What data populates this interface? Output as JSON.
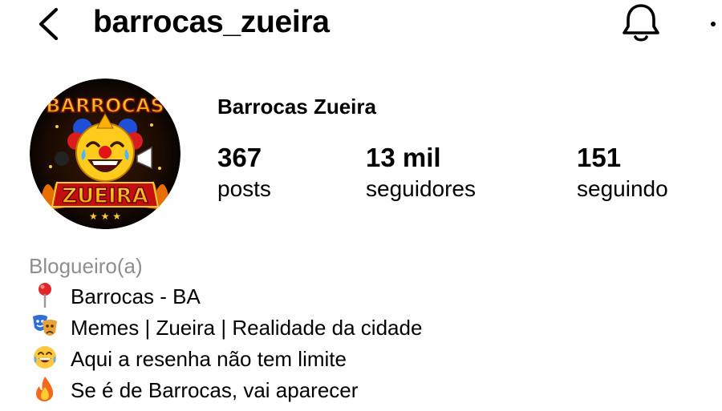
{
  "header": {
    "username": "barrocas_zueira",
    "back_icon": "chevron-left-icon",
    "bell_icon": "bell-icon",
    "more_icon": "more-dots-icon"
  },
  "profile": {
    "display_name": "Barrocas Zueira",
    "avatar_text_top": "BARROCAS",
    "avatar_text_bottom": "ZUEIRA",
    "stats": {
      "posts": {
        "value": "367",
        "label": "posts"
      },
      "followers": {
        "value": "13 mil",
        "label": "seguidores"
      },
      "following": {
        "value": "151",
        "label": "seguindo"
      }
    }
  },
  "bio": {
    "category": "Blogueiro(a)",
    "lines": [
      {
        "icon": "pin-icon",
        "text": "Barrocas - BA"
      },
      {
        "icon": "theater-masks-icon",
        "text": "Memes | Zueira | Realidade da cidade"
      },
      {
        "icon": "laughing-emoji-icon",
        "text": "Aqui a resenha não tem limite"
      },
      {
        "icon": "fire-icon",
        "text": "Se é de Barrocas, vai aparecer"
      }
    ]
  },
  "colors": {
    "text": "#000000",
    "secondary": "#8e8e8e",
    "background": "#ffffff"
  }
}
